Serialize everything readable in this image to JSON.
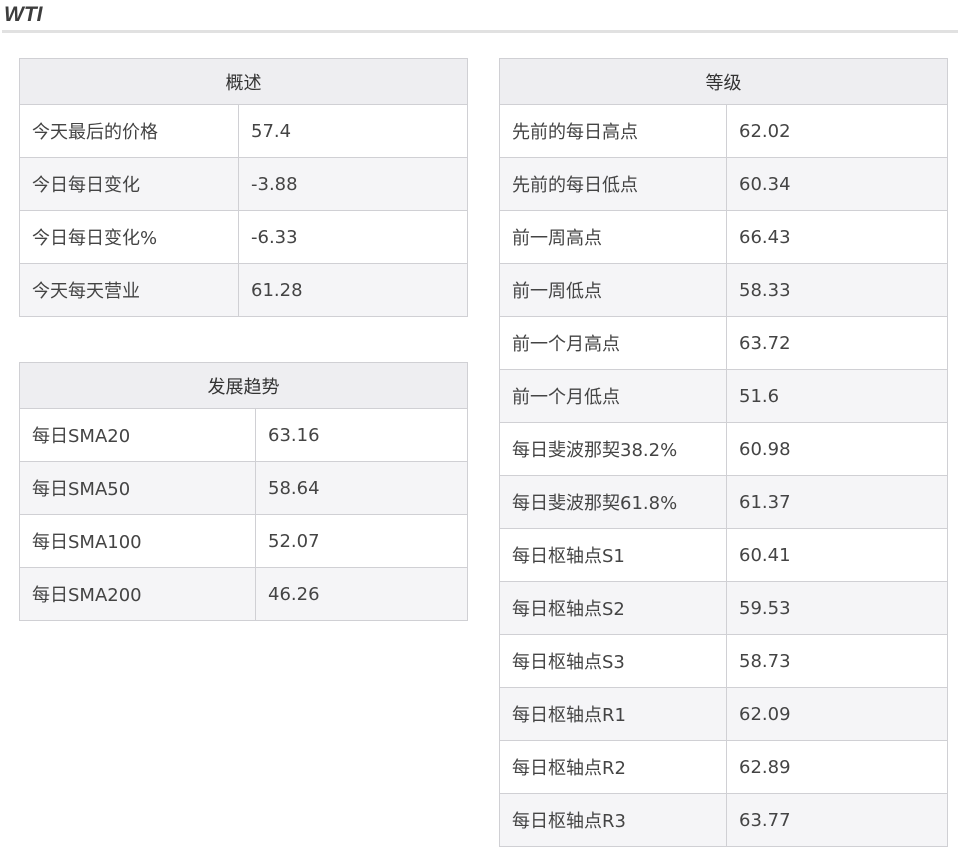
{
  "page": {
    "title": "WTI"
  },
  "overview": {
    "header": "概述",
    "rows": [
      {
        "label": "今天最后的价格",
        "value": "57.4"
      },
      {
        "label": "今日每日变化",
        "value": "-3.88"
      },
      {
        "label": "今日每日变化%",
        "value": "-6.33"
      },
      {
        "label": "今天每天营业",
        "value": "61.28"
      }
    ]
  },
  "trend": {
    "header": "发展趋势",
    "rows": [
      {
        "label": "每日SMA20",
        "value": "63.16"
      },
      {
        "label": "每日SMA50",
        "value": "58.64"
      },
      {
        "label": "每日SMA100",
        "value": "52.07"
      },
      {
        "label": "每日SMA200",
        "value": "46.26"
      }
    ]
  },
  "levels": {
    "header": "等级",
    "rows": [
      {
        "label": "先前的每日高点",
        "value": "62.02"
      },
      {
        "label": "先前的每日低点",
        "value": "60.34"
      },
      {
        "label": "前一周高点",
        "value": "66.43"
      },
      {
        "label": "前一周低点",
        "value": "58.33"
      },
      {
        "label": "前一个月高点",
        "value": "63.72"
      },
      {
        "label": "前一个月低点",
        "value": "51.6"
      },
      {
        "label": "每日斐波那契38.2%",
        "value": "60.98"
      },
      {
        "label": "每日斐波那契61.8%",
        "value": "61.37"
      },
      {
        "label": "每日枢轴点S1",
        "value": "60.41"
      },
      {
        "label": "每日枢轴点S2",
        "value": "59.53"
      },
      {
        "label": "每日枢轴点S3",
        "value": "58.73"
      },
      {
        "label": "每日枢轴点R1",
        "value": "62.09"
      },
      {
        "label": "每日枢轴点R2",
        "value": "62.89"
      },
      {
        "label": "每日枢轴点R3",
        "value": "63.77"
      }
    ]
  }
}
